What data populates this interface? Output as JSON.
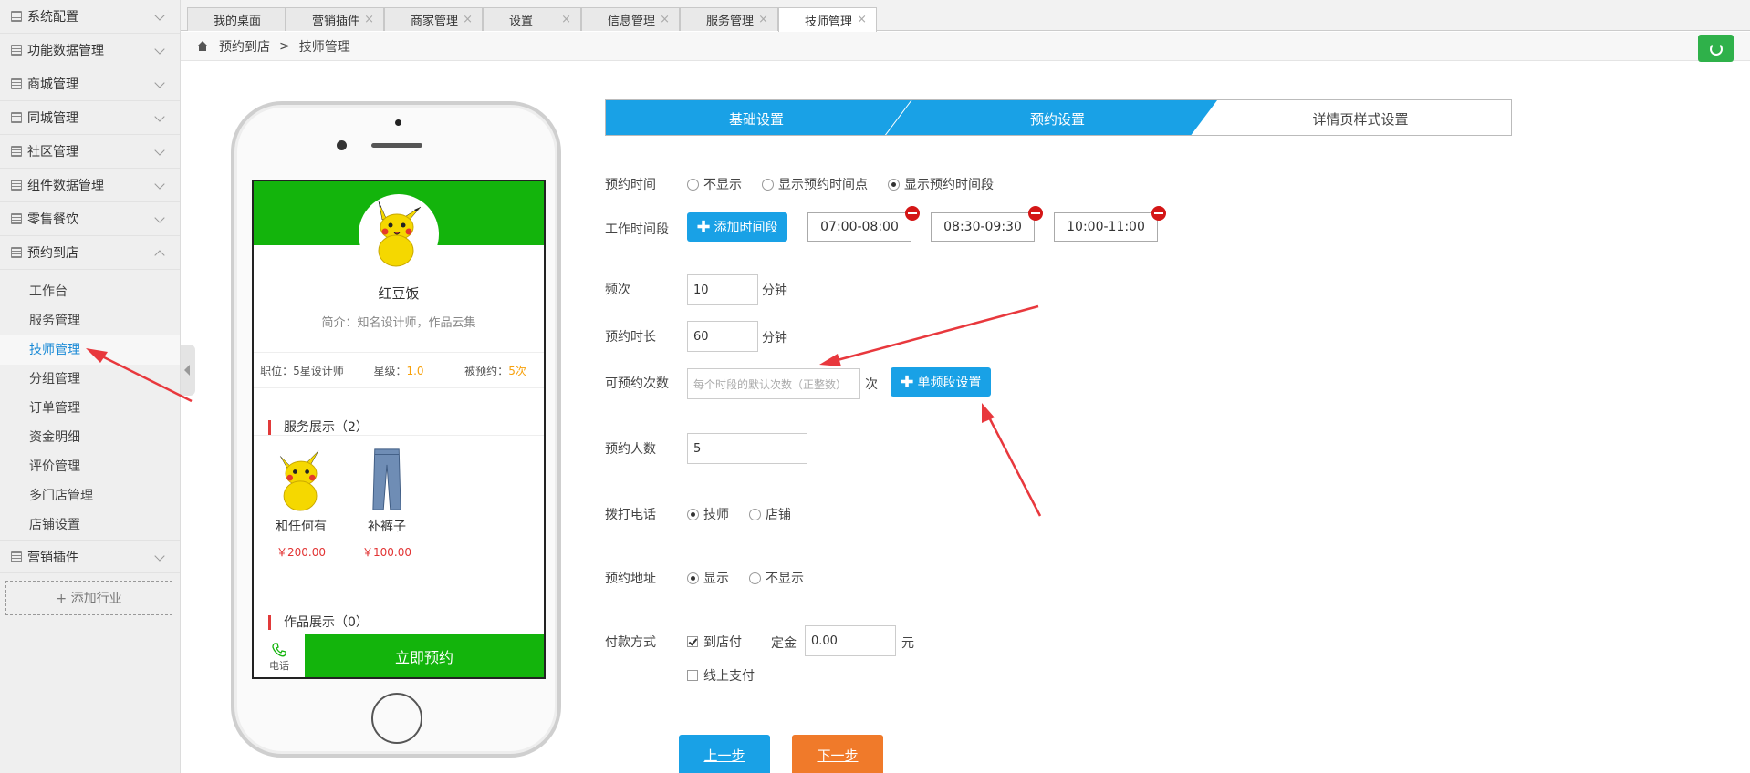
{
  "sidebar": {
    "groups": [
      {
        "label": "系统配置"
      },
      {
        "label": "功能数据管理"
      },
      {
        "label": "商城管理"
      },
      {
        "label": "同城管理"
      },
      {
        "label": "社区管理"
      },
      {
        "label": "组件数据管理"
      },
      {
        "label": "零售餐饮"
      },
      {
        "label": "预约到店"
      }
    ],
    "subitems": [
      "工作台",
      "服务管理",
      "技师管理",
      "分组管理",
      "订单管理",
      "资金明细",
      "评价管理",
      "多门店管理",
      "店铺设置"
    ],
    "active_subitem": "技师管理",
    "last_group": "营销插件",
    "add_industry": "+ 添加行业"
  },
  "tabs": [
    {
      "label": "我的桌面"
    },
    {
      "label": "营销插件",
      "close": "×"
    },
    {
      "label": "商家管理",
      "close": "×"
    },
    {
      "label": "设置",
      "close": "×"
    },
    {
      "label": "信息管理",
      "close": "×"
    },
    {
      "label": "服务管理",
      "close": "×"
    },
    {
      "label": "技师管理",
      "close": "×"
    }
  ],
  "breadcrumb": {
    "parent": "预约到店",
    "sep": ">",
    "current": "技师管理"
  },
  "phone": {
    "name": "红豆饭",
    "intro": "简介：知名设计师，作品云集",
    "position_label": "职位：5星设计师",
    "stars_label": "星级：",
    "stars_value": "1.0",
    "booked_label": "被预约：",
    "booked_value": "5次",
    "services_title": "服务展示（2）",
    "products": [
      {
        "name": "和任何有",
        "price": "￥200.00"
      },
      {
        "name": "补裤子",
        "price": "￥100.00"
      }
    ],
    "works_title": "作品展示（0）",
    "call_label": "电话",
    "book_label": "立即预约"
  },
  "steps": [
    "基础设置",
    "预约设置",
    "详情页样式设置"
  ],
  "form": {
    "time_label": "预约时间",
    "time_options": [
      "不显示",
      "显示预约时间点",
      "显示预约时间段"
    ],
    "time_selected": 2,
    "work_period_label": "工作时间段",
    "add_period_btn": "添加时间段",
    "periods": [
      "07:00-08:00",
      "08:30-09:30",
      "10:00-11:00"
    ],
    "frequency_label": "频次",
    "frequency_value": "10",
    "minute_unit": "分钟",
    "duration_label": "预约时长",
    "duration_value": "60",
    "count_label": "可预约次数",
    "count_placeholder": "每个时段的默认次数（正整数）",
    "count_unit": "次",
    "single_period_btn": "单频段设置",
    "people_label": "预约人数",
    "people_value": "5",
    "phone_label": "拨打电话",
    "phone_options": [
      "技师",
      "店铺"
    ],
    "phone_selected": 0,
    "address_label": "预约地址",
    "address_options": [
      "显示",
      "不显示"
    ],
    "address_selected": 0,
    "pay_label": "付款方式",
    "pay_store": "到店付",
    "pay_store_checked": true,
    "deposit_label": "定金",
    "deposit_value": "0.00",
    "yuan_unit": "元",
    "pay_online": "线上支付",
    "pay_online_checked": false,
    "prev_btn": "上一步",
    "next_btn": "下一步"
  },
  "colors": {
    "accent_blue": "#19a1e6",
    "green": "#13b40c",
    "orange": "#f07a2a",
    "red_arrow": "#e8383d"
  }
}
